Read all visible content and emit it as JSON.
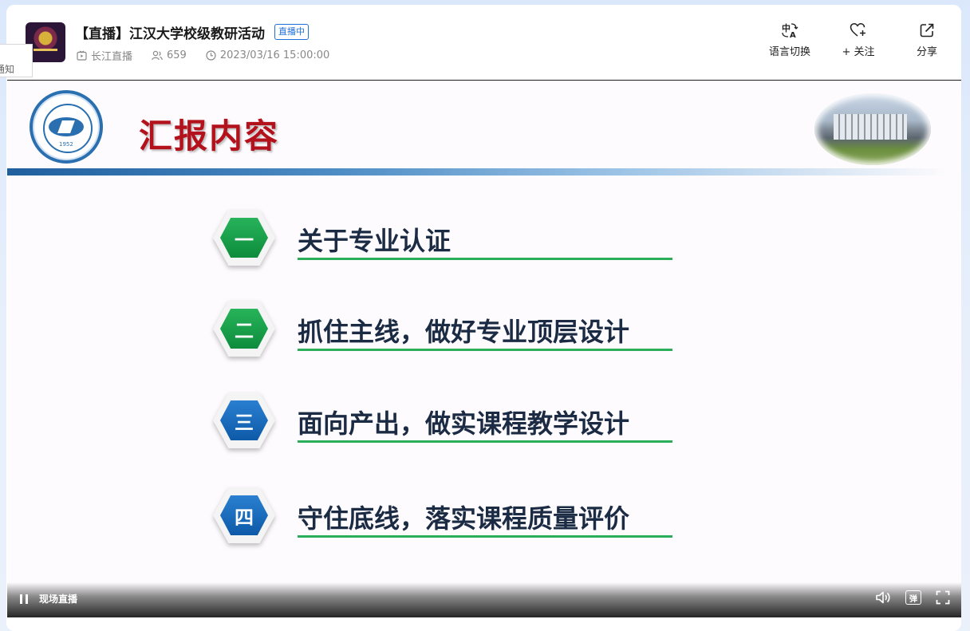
{
  "header": {
    "title": "【直播】江汉大学校级教研活动",
    "live_badge": "直播中",
    "meta": {
      "channel": "长江直播",
      "viewers": "659",
      "datetime": "2023/03/16 15:00:00"
    },
    "actions": [
      {
        "label": "语言切换",
        "icon": "translate-icon"
      },
      {
        "label": "+ 关注",
        "icon": "heart-plus-icon"
      },
      {
        "label": "分享",
        "icon": "share-icon"
      }
    ]
  },
  "side_tab": {
    "label": "通知"
  },
  "slide": {
    "title": "汇报内容",
    "emblem_year": "1952",
    "items": [
      {
        "num": "一",
        "text": "关于专业认证",
        "color": "#0d8c3c"
      },
      {
        "num": "二",
        "text": "抓住主线，做好专业顶层设计",
        "color": "#0d8c3c"
      },
      {
        "num": "三",
        "text": "面向产出，做实课程教学设计",
        "color": "#0d5aa8"
      },
      {
        "num": "四",
        "text": "守住底线，落实课程质量评价",
        "color": "#0d5aa8"
      }
    ]
  },
  "player": {
    "live_label": "现场直播",
    "danmaku_label": "弹"
  }
}
